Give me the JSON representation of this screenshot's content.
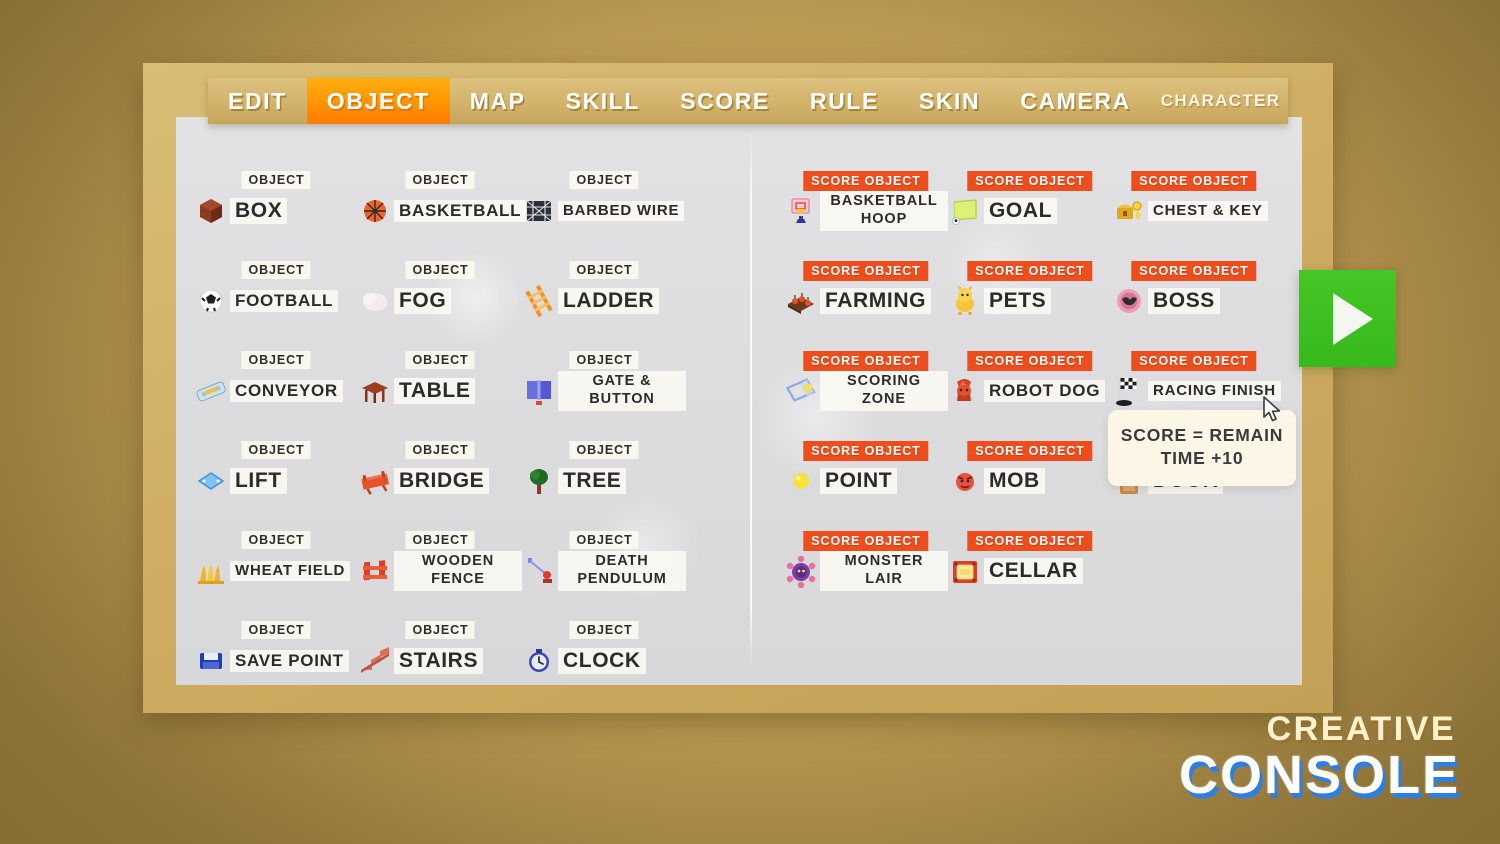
{
  "window": {
    "background_color": "#c3a158",
    "frame_color": "#cfae63",
    "panel_color": "#dddddf"
  },
  "tabs": [
    {
      "label": "EDIT",
      "active": false,
      "small": false
    },
    {
      "label": "OBJECT",
      "active": true,
      "small": false
    },
    {
      "label": "MAP",
      "active": false,
      "small": false
    },
    {
      "label": "SKILL",
      "active": false,
      "small": false
    },
    {
      "label": "SCORE",
      "active": false,
      "small": false
    },
    {
      "label": "RULE",
      "active": false,
      "small": false
    },
    {
      "label": "SKIN",
      "active": false,
      "small": false
    },
    {
      "label": "CAMERA",
      "active": false,
      "small": false
    },
    {
      "label": "CHARACTER",
      "active": false,
      "small": true
    }
  ],
  "badges": {
    "object": "OBJECT",
    "score_object": "SCORE OBJECT",
    "object_color": "#fcfaf0",
    "score_object_color": "#f04d1c"
  },
  "objects": [
    {
      "name": "BOX",
      "icon": "box-icon",
      "badge": "OBJECT",
      "lines": 1
    },
    {
      "name": "BASKETBALL",
      "icon": "basketball-icon",
      "badge": "OBJECT",
      "lines": 1
    },
    {
      "name": "BARBED WIRE",
      "icon": "barbed-wire-icon",
      "badge": "OBJECT",
      "lines": 1
    },
    {
      "name": "FOOTBALL",
      "icon": "football-icon",
      "badge": "OBJECT",
      "lines": 1
    },
    {
      "name": "FOG",
      "icon": "fog-icon",
      "badge": "OBJECT",
      "lines": 1
    },
    {
      "name": "LADDER",
      "icon": "ladder-icon",
      "badge": "OBJECT",
      "lines": 1
    },
    {
      "name": "CONVEYOR",
      "icon": "conveyor-icon",
      "badge": "OBJECT",
      "lines": 1
    },
    {
      "name": "TABLE",
      "icon": "table-icon",
      "badge": "OBJECT",
      "lines": 1
    },
    {
      "name": "GATE & BUTTON",
      "icon": "gate-button-icon",
      "badge": "OBJECT",
      "lines": 2
    },
    {
      "name": "LIFT",
      "icon": "lift-icon",
      "badge": "OBJECT",
      "lines": 1
    },
    {
      "name": "BRIDGE",
      "icon": "bridge-icon",
      "badge": "OBJECT",
      "lines": 1
    },
    {
      "name": "TREE",
      "icon": "tree-icon",
      "badge": "OBJECT",
      "lines": 1
    },
    {
      "name": "WHEAT FIELD",
      "icon": "wheat-field-icon",
      "badge": "OBJECT",
      "lines": 1
    },
    {
      "name": "WOODEN FENCE",
      "icon": "wooden-fence-icon",
      "badge": "OBJECT",
      "lines": 2
    },
    {
      "name": "DEATH PENDULUM",
      "icon": "death-pendulum-icon",
      "badge": "OBJECT",
      "lines": 2
    },
    {
      "name": "SAVE POINT",
      "icon": "save-point-icon",
      "badge": "OBJECT",
      "lines": 1
    },
    {
      "name": "STAIRS",
      "icon": "stairs-icon",
      "badge": "OBJECT",
      "lines": 1
    },
    {
      "name": "CLOCK",
      "icon": "clock-icon",
      "badge": "OBJECT",
      "lines": 1
    }
  ],
  "score_objects": [
    {
      "name": "BASKETBALL HOOP",
      "icon": "basketball-hoop-icon",
      "badge": "SCORE OBJECT",
      "lines": 2
    },
    {
      "name": "GOAL",
      "icon": "goal-icon",
      "badge": "SCORE OBJECT",
      "lines": 1
    },
    {
      "name": "CHEST & KEY",
      "icon": "chest-key-icon",
      "badge": "SCORE OBJECT",
      "lines": 1
    },
    {
      "name": "FARMING",
      "icon": "farming-icon",
      "badge": "SCORE OBJECT",
      "lines": 1
    },
    {
      "name": "PETS",
      "icon": "pets-icon",
      "badge": "SCORE OBJECT",
      "lines": 1
    },
    {
      "name": "BOSS",
      "icon": "boss-icon",
      "badge": "SCORE OBJECT",
      "lines": 1
    },
    {
      "name": "SCORING ZONE",
      "icon": "scoring-zone-icon",
      "badge": "SCORE OBJECT",
      "lines": 2
    },
    {
      "name": "ROBOT DOG",
      "icon": "robot-dog-icon",
      "badge": "SCORE OBJECT",
      "lines": 1
    },
    {
      "name": "RACING FINISH",
      "icon": "racing-finish-icon",
      "badge": "SCORE OBJECT",
      "lines": 1
    },
    {
      "name": "POINT",
      "icon": "point-icon",
      "badge": "SCORE OBJECT",
      "lines": 1
    },
    {
      "name": "MOB",
      "icon": "mob-icon",
      "badge": "SCORE OBJECT",
      "lines": 1
    },
    {
      "name": "DOOR",
      "icon": "door-icon",
      "badge": "SCORE OBJECT",
      "lines": 1
    },
    {
      "name": "MONSTER LAIR",
      "icon": "monster-lair-icon",
      "badge": "SCORE OBJECT",
      "lines": 2
    },
    {
      "name": "CELLAR",
      "icon": "cellar-icon",
      "badge": "SCORE OBJECT",
      "lines": 1
    }
  ],
  "tooltip": {
    "text": "SCORE = REMAIN TIME +10",
    "background_color": "#fbf6e6"
  },
  "play_button": {
    "icon": "play-icon",
    "color": "#3dc11f"
  },
  "logo": {
    "line1": "CREATIVE",
    "line2": "CONSOLE",
    "line1_color": "#fdf2cd",
    "line2_color": "#ffffff",
    "line2_shadow_color": "#2f7fe0"
  },
  "cursor": {
    "icon": "mouse-pointer-icon"
  }
}
